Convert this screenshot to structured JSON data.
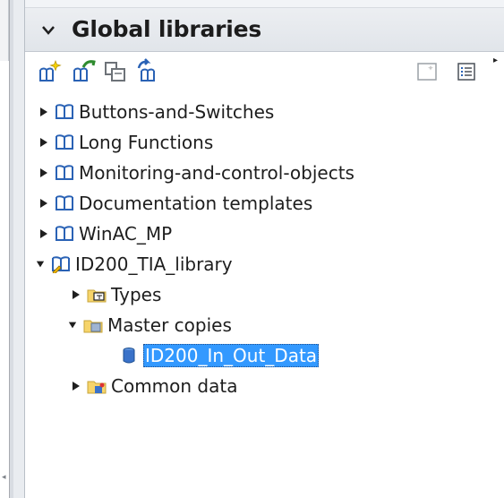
{
  "panel": {
    "title": "Global libraries"
  },
  "toolbar": {
    "icons": [
      "new-library-icon",
      "open-library-icon",
      "save-library-icon",
      "close-library-icon",
      "library-view-icon",
      "details-view-icon"
    ]
  },
  "tree": {
    "items": [
      {
        "label": "Buttons-and-Switches",
        "level": 0,
        "expanded": false,
        "icon": "library-book-icon"
      },
      {
        "label": "Long Functions",
        "level": 0,
        "expanded": false,
        "icon": "library-book-icon"
      },
      {
        "label": "Monitoring-and-control-objects",
        "level": 0,
        "expanded": false,
        "icon": "library-book-icon"
      },
      {
        "label": "Documentation templates",
        "level": 0,
        "expanded": false,
        "icon": "library-book-icon"
      },
      {
        "label": "WinAC_MP",
        "level": 0,
        "expanded": false,
        "icon": "library-book-icon"
      },
      {
        "label": "ID200_TIA_library",
        "level": 0,
        "expanded": true,
        "icon": "editable-library-icon"
      },
      {
        "label": "Types",
        "level": 1,
        "expanded": false,
        "icon": "types-folder-icon"
      },
      {
        "label": "Master copies",
        "level": 1,
        "expanded": true,
        "icon": "master-copies-folder-icon"
      },
      {
        "label": "ID200_In_Out_Data",
        "level": 2,
        "selected": true,
        "icon": "data-block-icon"
      },
      {
        "label": "Common data",
        "level": 1,
        "expanded": false,
        "icon": "common-data-folder-icon"
      }
    ]
  }
}
